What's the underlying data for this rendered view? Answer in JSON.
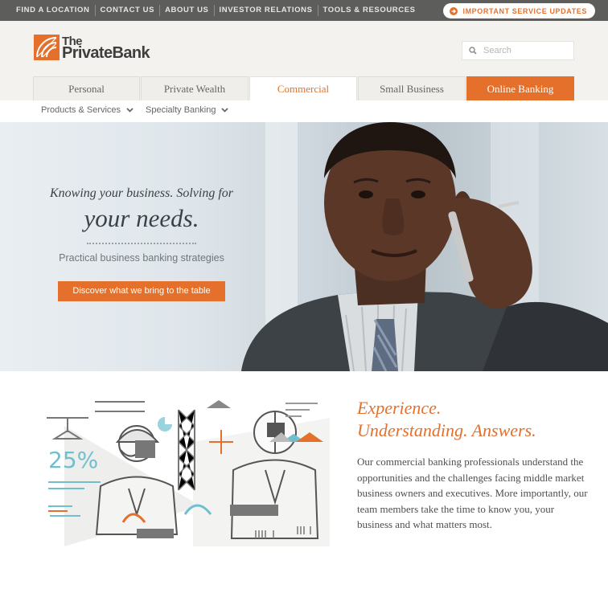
{
  "topbar": {
    "links": [
      "FIND A LOCATION",
      "CONTACT US",
      "ABOUT US",
      "INVESTOR RELATIONS",
      "TOOLS & RESOURCES"
    ],
    "alert_label": "IMPORTANT SERVICE UPDATES"
  },
  "header": {
    "logo_line1": "The",
    "logo_line2": "PrivateBank",
    "search_placeholder": "Search"
  },
  "tabs": [
    {
      "label": "Personal",
      "state": "default"
    },
    {
      "label": "Private Wealth",
      "state": "default"
    },
    {
      "label": "Commercial",
      "state": "active"
    },
    {
      "label": "Small Business",
      "state": "default"
    },
    {
      "label": "Online Banking",
      "state": "highlight"
    }
  ],
  "subnav": {
    "items": [
      "Products & Services",
      "Specialty Banking"
    ]
  },
  "hero": {
    "line1": "Knowing your business. Solving for",
    "line2": "your needs.",
    "subtitle": "Practical business banking strategies",
    "cta": "Discover what we bring to the table"
  },
  "illustration": {
    "percent": "25%"
  },
  "section": {
    "heading_line1": "Experience.",
    "heading_line2": "Understanding. Answers.",
    "body": "Our commercial banking professionals understand the opportunities and the challenges facing middle market business owners and executives. More importantly, our team members take the time to know you, your business and what matters most."
  },
  "colors": {
    "accent": "#e4702c",
    "topbar": "#5d5d5b",
    "header_bg": "#f3f2ef",
    "illustration_teal": "#6fbfcf"
  },
  "icons": [
    "arrow-right-icon",
    "search-icon",
    "chevron-down-icon",
    "logo-mark-icon"
  ]
}
